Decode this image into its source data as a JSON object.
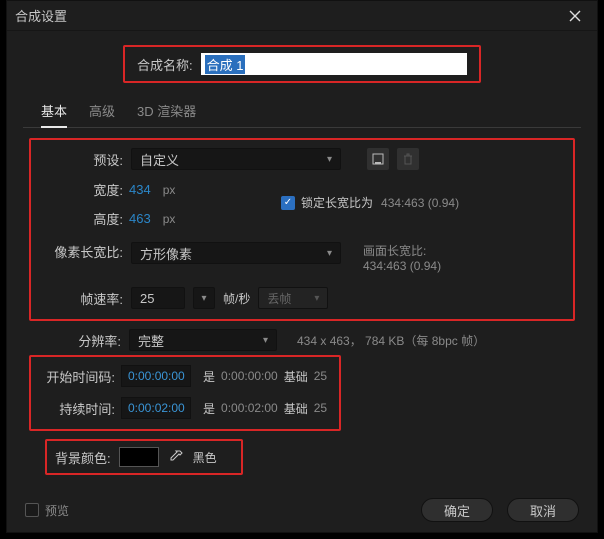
{
  "window": {
    "title": "合成设置"
  },
  "name": {
    "label": "合成名称:",
    "value": "合成 1"
  },
  "tabs": {
    "basic": "基本",
    "advanced": "高级",
    "renderer": "3D 渲染器"
  },
  "preset": {
    "label": "预设:",
    "value": "自定义"
  },
  "width": {
    "label": "宽度:",
    "value": "434",
    "unit": "px"
  },
  "height": {
    "label": "高度:",
    "value": "463",
    "unit": "px"
  },
  "lock": {
    "label": "锁定长宽比为",
    "ratio": "434:463 (0.94)"
  },
  "par": {
    "label": "像素长宽比:",
    "value": "方形像素",
    "far_label": "画面长宽比:",
    "far_value": "434:463 (0.94)"
  },
  "fps": {
    "label": "帧速率:",
    "value": "25",
    "unit": "帧/秒",
    "drop": "丢帧"
  },
  "res": {
    "label": "分辨率:",
    "value": "完整",
    "info": "434 x 463， 784 KB（每 8bpc 帧）"
  },
  "start": {
    "label": "开始时间码:",
    "value": "0:00:00:00",
    "is": "是",
    "base_v": "0:00:00:00",
    "base_l": "基础",
    "base_n": "25"
  },
  "dur": {
    "label": "持续时间:",
    "value": "0:00:02:00",
    "is": "是",
    "base_v": "0:00:02:00",
    "base_l": "基础",
    "base_n": "25"
  },
  "bg": {
    "label": "背景颜色:",
    "color": "#000000",
    "name": "黑色"
  },
  "footer": {
    "preview": "预览",
    "ok": "确定",
    "cancel": "取消"
  }
}
